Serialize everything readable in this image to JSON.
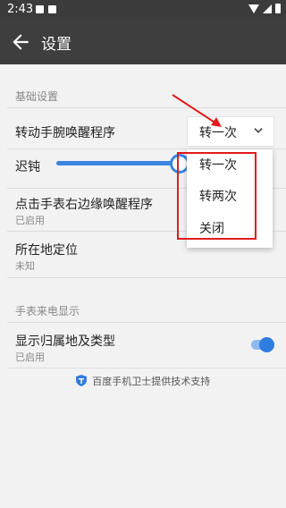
{
  "status_bar": {
    "time": "2:43"
  },
  "app_bar": {
    "title": "设置"
  },
  "sections": [
    {
      "title": "基础设置"
    },
    {
      "title": "手表来电显示"
    }
  ],
  "settings": {
    "wrist_wake": {
      "title": "转动手腕唤醒程序",
      "selected": "转一次"
    },
    "slider": {
      "label": "迟钝",
      "value_fraction": 0.95
    },
    "edge_wake": {
      "title": "点击手表右边缘唤醒程序",
      "subtitle": "已启用"
    },
    "location": {
      "title": "所在地定位",
      "subtitle": "未知"
    },
    "caller_display": {
      "title": "显示归属地及类型",
      "subtitle": "已启用",
      "enabled": true
    }
  },
  "dropdown": {
    "options": [
      "转一次",
      "转两次",
      "关闭"
    ]
  },
  "footer": {
    "text": "百度手机卫士提供技术支持"
  },
  "colors": {
    "accent": "#2f7de1",
    "annotation": "#e21b1b",
    "appbar": "#3e3e3e"
  },
  "icons": {
    "back": "back-arrow-icon",
    "chevron": "chevron-down-icon",
    "shield": "shield-icon"
  }
}
